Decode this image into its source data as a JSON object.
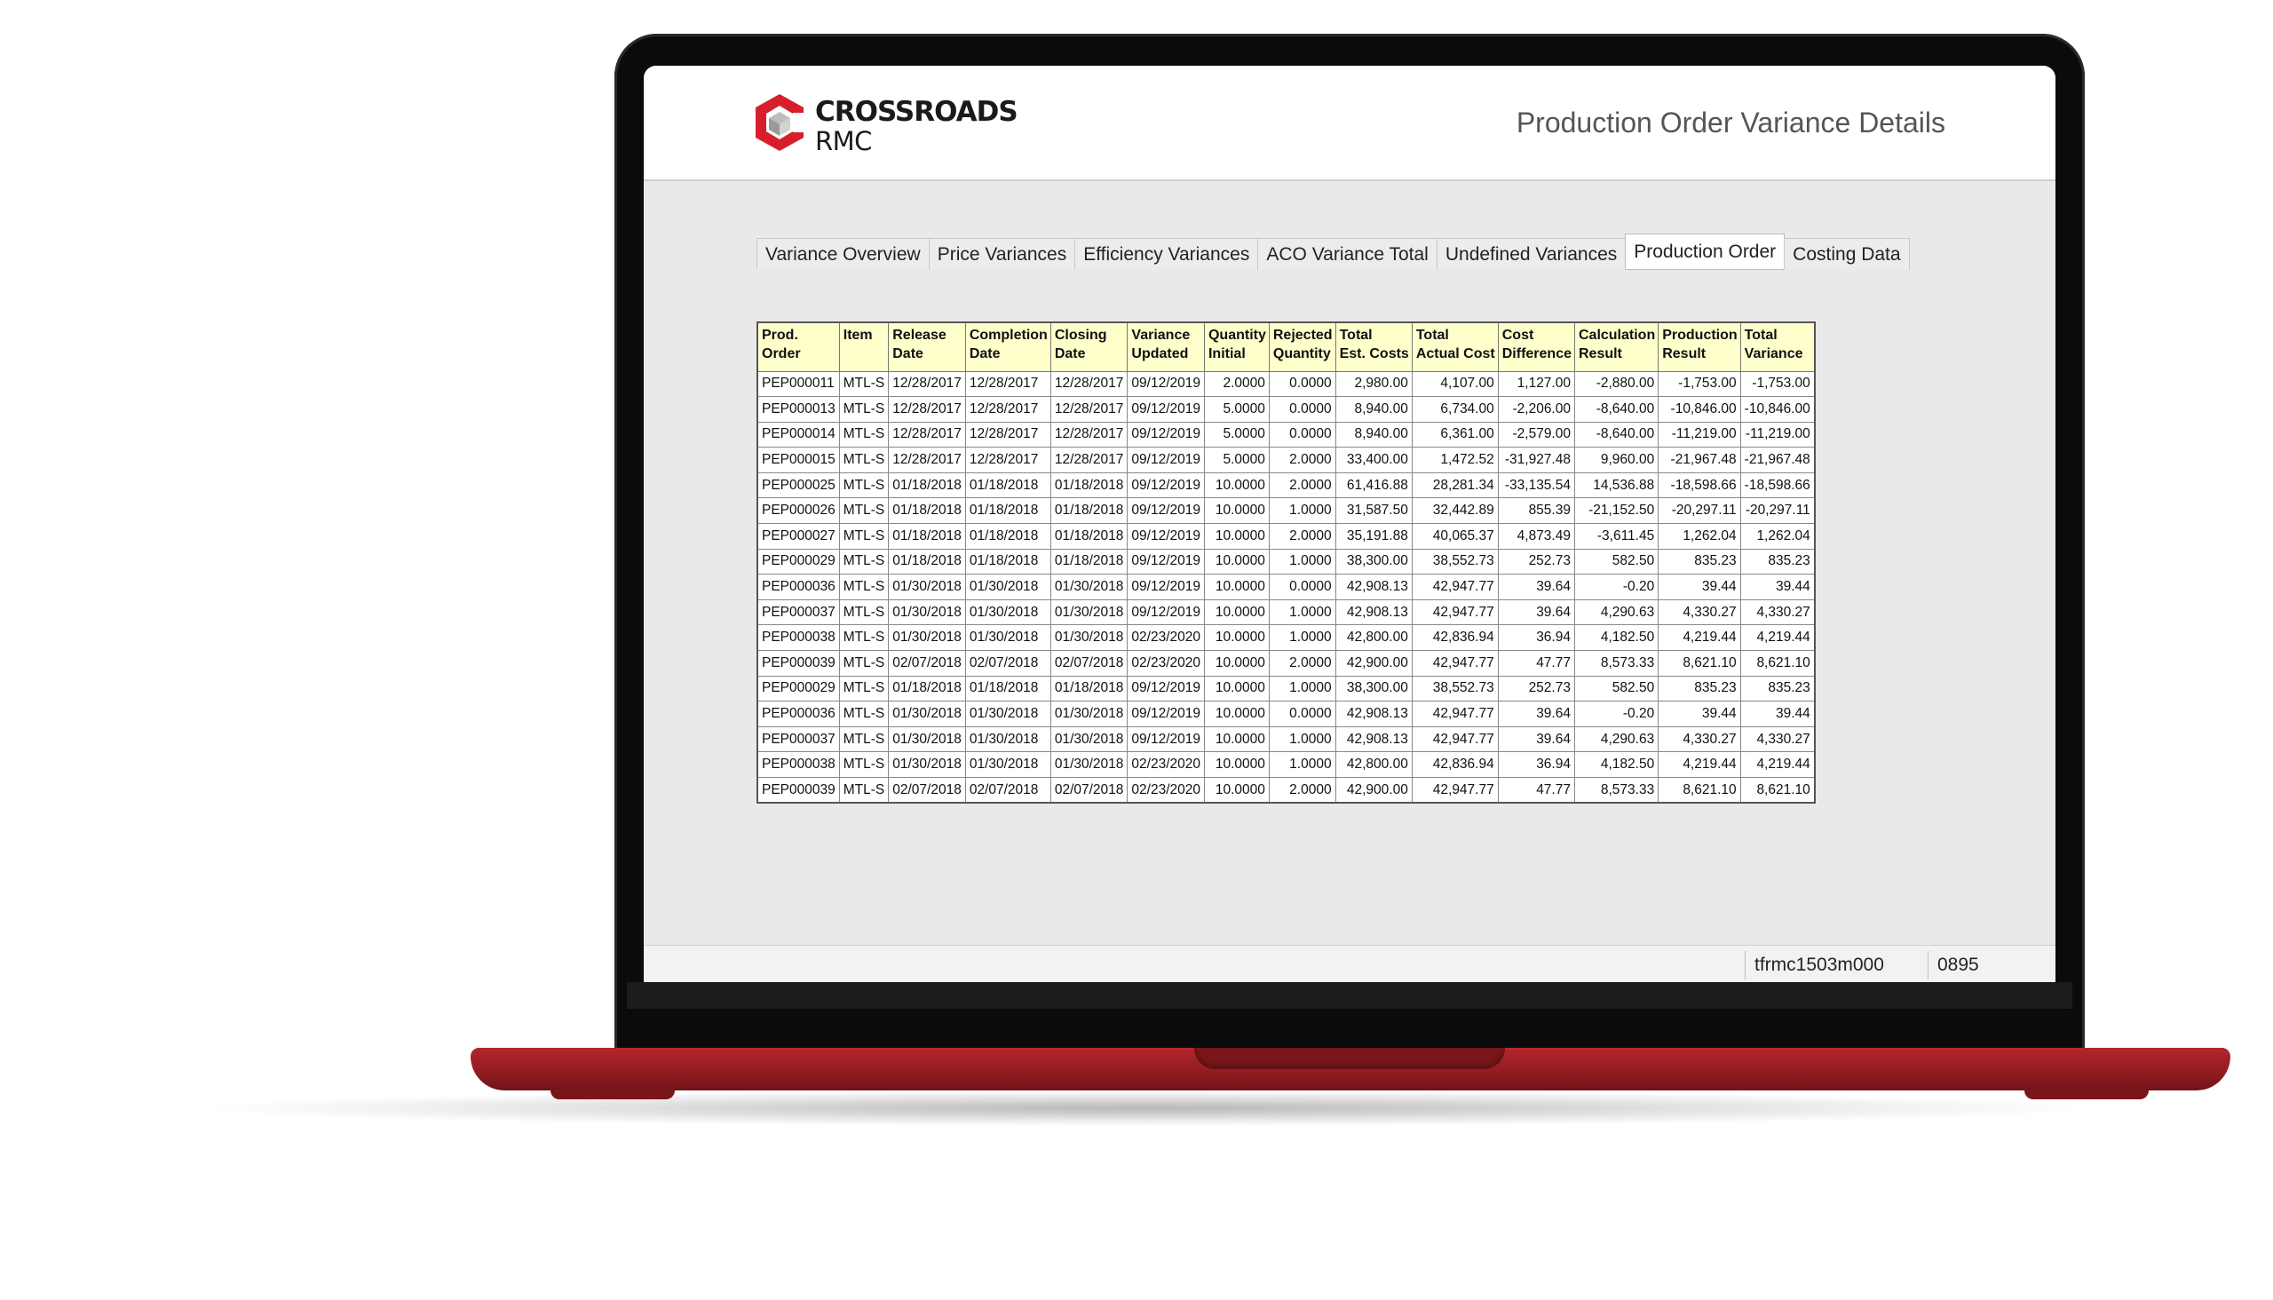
{
  "brand": {
    "line1": "CROSSROADS",
    "line2": "RMC",
    "primary_color": "#d71f2b"
  },
  "header": {
    "title": "Production Order Variance Details"
  },
  "tabs": [
    {
      "label": "Variance Overview",
      "active": false
    },
    {
      "label": "Price Variances",
      "active": false
    },
    {
      "label": "Efficiency Variances",
      "active": false
    },
    {
      "label": "ACO Variance Total",
      "active": false
    },
    {
      "label": "Undefined Variances",
      "active": false
    },
    {
      "label": "Production Order",
      "active": true
    },
    {
      "label": "Costing Data",
      "active": false
    }
  ],
  "table": {
    "columns": [
      [
        "Prod.",
        "Order"
      ],
      [
        "Item",
        ""
      ],
      [
        "Release",
        "Date"
      ],
      [
        "Completion",
        "Date"
      ],
      [
        "Closing",
        "Date"
      ],
      [
        "Variance",
        "Updated"
      ],
      [
        "Quantity",
        "Initial"
      ],
      [
        "Rejected",
        "Quantity"
      ],
      [
        "Total",
        "Est. Costs"
      ],
      [
        "Total",
        "Actual Cost"
      ],
      [
        "Cost",
        "Difference"
      ],
      [
        "Calculation",
        "Result"
      ],
      [
        "Production",
        "Result"
      ],
      [
        "Total",
        "Variance"
      ]
    ],
    "rows": [
      [
        "PEP000011",
        "MTL-S",
        "12/28/2017",
        "12/28/2017",
        "12/28/2017",
        "09/12/2019",
        "2.0000",
        "0.0000",
        "2,980.00",
        "4,107.00",
        "1,127.00",
        "-2,880.00",
        "-1,753.00",
        "-1,753.00"
      ],
      [
        "PEP000013",
        "MTL-S",
        "12/28/2017",
        "12/28/2017",
        "12/28/2017",
        "09/12/2019",
        "5.0000",
        "0.0000",
        "8,940.00",
        "6,734.00",
        "-2,206.00",
        "-8,640.00",
        "-10,846.00",
        "-10,846.00"
      ],
      [
        "PEP000014",
        "MTL-S",
        "12/28/2017",
        "12/28/2017",
        "12/28/2017",
        "09/12/2019",
        "5.0000",
        "0.0000",
        "8,940.00",
        "6,361.00",
        "-2,579.00",
        "-8,640.00",
        "-11,219.00",
        "-11,219.00"
      ],
      [
        "PEP000015",
        "MTL-S",
        "12/28/2017",
        "12/28/2017",
        "12/28/2017",
        "09/12/2019",
        "5.0000",
        "2.0000",
        "33,400.00",
        "1,472.52",
        "-31,927.48",
        "9,960.00",
        "-21,967.48",
        "-21,967.48"
      ],
      [
        "PEP000025",
        "MTL-S",
        "01/18/2018",
        "01/18/2018",
        "01/18/2018",
        "09/12/2019",
        "10.0000",
        "2.0000",
        "61,416.88",
        "28,281.34",
        "-33,135.54",
        "14,536.88",
        "-18,598.66",
        "-18,598.66"
      ],
      [
        "PEP000026",
        "MTL-S",
        "01/18/2018",
        "01/18/2018",
        "01/18/2018",
        "09/12/2019",
        "10.0000",
        "1.0000",
        "31,587.50",
        "32,442.89",
        "855.39",
        "-21,152.50",
        "-20,297.11",
        "-20,297.11"
      ],
      [
        "PEP000027",
        "MTL-S",
        "01/18/2018",
        "01/18/2018",
        "01/18/2018",
        "09/12/2019",
        "10.0000",
        "2.0000",
        "35,191.88",
        "40,065.37",
        "4,873.49",
        "-3,611.45",
        "1,262.04",
        "1,262.04"
      ],
      [
        "PEP000029",
        "MTL-S",
        "01/18/2018",
        "01/18/2018",
        "01/18/2018",
        "09/12/2019",
        "10.0000",
        "1.0000",
        "38,300.00",
        "38,552.73",
        "252.73",
        "582.50",
        "835.23",
        "835.23"
      ],
      [
        "PEP000036",
        "MTL-S",
        "01/30/2018",
        "01/30/2018",
        "01/30/2018",
        "09/12/2019",
        "10.0000",
        "0.0000",
        "42,908.13",
        "42,947.77",
        "39.64",
        "-0.20",
        "39.44",
        "39.44"
      ],
      [
        "PEP000037",
        "MTL-S",
        "01/30/2018",
        "01/30/2018",
        "01/30/2018",
        "09/12/2019",
        "10.0000",
        "1.0000",
        "42,908.13",
        "42,947.77",
        "39.64",
        "4,290.63",
        "4,330.27",
        "4,330.27"
      ],
      [
        "PEP000038",
        "MTL-S",
        "01/30/2018",
        "01/30/2018",
        "01/30/2018",
        "02/23/2020",
        "10.0000",
        "1.0000",
        "42,800.00",
        "42,836.94",
        "36.94",
        "4,182.50",
        "4,219.44",
        "4,219.44"
      ],
      [
        "PEP000039",
        "MTL-S",
        "02/07/2018",
        "02/07/2018",
        "02/07/2018",
        "02/23/2020",
        "10.0000",
        "2.0000",
        "42,900.00",
        "42,947.77",
        "47.77",
        "8,573.33",
        "8,621.10",
        "8,621.10"
      ],
      [
        "PEP000029",
        "MTL-S",
        "01/18/2018",
        "01/18/2018",
        "01/18/2018",
        "09/12/2019",
        "10.0000",
        "1.0000",
        "38,300.00",
        "38,552.73",
        "252.73",
        "582.50",
        "835.23",
        "835.23"
      ],
      [
        "PEP000036",
        "MTL-S",
        "01/30/2018",
        "01/30/2018",
        "01/30/2018",
        "09/12/2019",
        "10.0000",
        "0.0000",
        "42,908.13",
        "42,947.77",
        "39.64",
        "-0.20",
        "39.44",
        "39.44"
      ],
      [
        "PEP000037",
        "MTL-S",
        "01/30/2018",
        "01/30/2018",
        "01/30/2018",
        "09/12/2019",
        "10.0000",
        "1.0000",
        "42,908.13",
        "42,947.77",
        "39.64",
        "4,290.63",
        "4,330.27",
        "4,330.27"
      ],
      [
        "PEP000038",
        "MTL-S",
        "01/30/2018",
        "01/30/2018",
        "01/30/2018",
        "02/23/2020",
        "10.0000",
        "1.0000",
        "42,800.00",
        "42,836.94",
        "36.94",
        "4,182.50",
        "4,219.44",
        "4,219.44"
      ],
      [
        "PEP000039",
        "MTL-S",
        "02/07/2018",
        "02/07/2018",
        "02/07/2018",
        "02/23/2020",
        "10.0000",
        "2.0000",
        "42,900.00",
        "42,947.77",
        "47.77",
        "8,573.33",
        "8,621.10",
        "8,621.10"
      ]
    ]
  },
  "statusbar": {
    "session_code": "tfrmc1503m000",
    "company": "0895"
  }
}
